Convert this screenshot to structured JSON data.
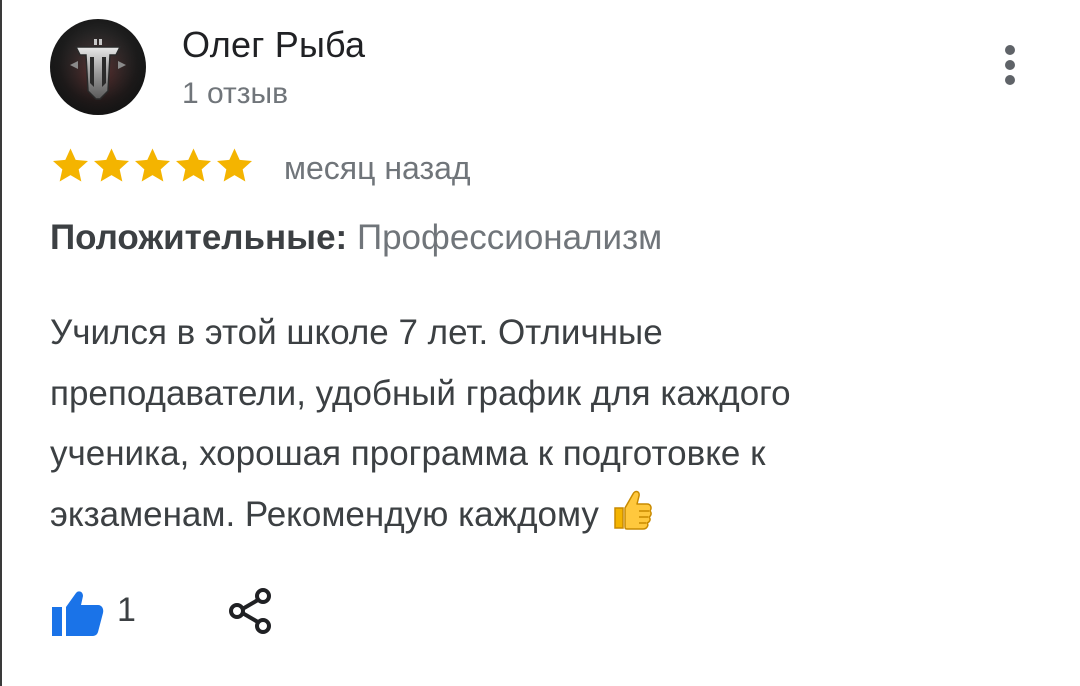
{
  "review": {
    "author_name": "Олег Рыба",
    "review_count": "1 отзыв",
    "rating": 5,
    "rating_max": 5,
    "date": "месяц назад",
    "positive_label": "Положительные:",
    "positive_value": "Профессионализм",
    "text_lines": [
      "Учился в этой школе 7 лет. Отличные",
      "преподаватели, удобный график для каждого",
      "ученика, хорошая программа к подготовке к",
      "экзаменам. Рекомендую каждому"
    ],
    "likes": "1"
  },
  "icons": {
    "avatar": "world-of-tanks-logo-avatar",
    "more": "more-vertical-icon",
    "star": "star-icon",
    "thumbs_up_emoji": "thumbs-up-emoji",
    "like": "thumb-up-icon",
    "share": "share-icon"
  },
  "colors": {
    "star": "#f4b400",
    "accent_blue": "#1a73e8",
    "primary_text": "#202124",
    "secondary_text": "#70757a",
    "body_text": "#3c4043"
  }
}
